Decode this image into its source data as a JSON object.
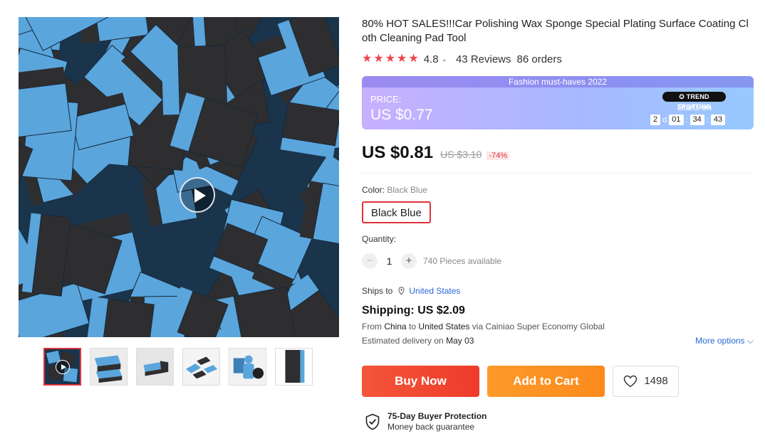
{
  "product": {
    "title": "80% HOT SALES!!!Car Polishing Wax Sponge Special Plating Surface Coating Cloth Cleaning Pad Tool",
    "rating": "4.8",
    "reviews": "43 Reviews",
    "orders": "86 orders"
  },
  "promo": {
    "banner": "Fashion must-haves 2022",
    "price_label": "PRICE:",
    "price": "US $0.77",
    "badge": "TREND SPOTTING",
    "starts_on": "Starts on",
    "countdown": {
      "days": "2",
      "d": "d",
      "hours": "01",
      "minutes": "34",
      "seconds": "43",
      "sep": ":"
    }
  },
  "price": {
    "current": "US $0.81",
    "original": "US $3.10",
    "discount": "-74%"
  },
  "color": {
    "label": "Color:",
    "selected": "Black Blue",
    "option": "Black Blue"
  },
  "quantity": {
    "label": "Quantity:",
    "minus": "−",
    "value": "1",
    "plus": "+",
    "available": "740 Pieces available"
  },
  "shipping": {
    "ships_to_label": "Ships to",
    "ships_to_country": "United States",
    "cost": "Shipping: US $2.09",
    "from_word": "From",
    "from_country": "China",
    "to_word": "to",
    "to_country": "United States",
    "via": "via Cainiao Super Economy Global",
    "delivery_prefix": "Estimated delivery on",
    "delivery_date": "May 03",
    "more_options": "More options"
  },
  "actions": {
    "buy_now": "Buy Now",
    "add_to_cart": "Add to Cart",
    "wishlist_count": "1498"
  },
  "protection": {
    "title": "75-Day Buyer Protection",
    "subtitle": "Money back guarantee"
  },
  "colors": {
    "accent_red": "#e0323c",
    "buy_button": "#f4553a",
    "cart_button": "#fd9a2a",
    "link_blue": "#2b68d8",
    "sponge_blue": "#5aa5dc",
    "sponge_dark": "#2e2e30"
  }
}
